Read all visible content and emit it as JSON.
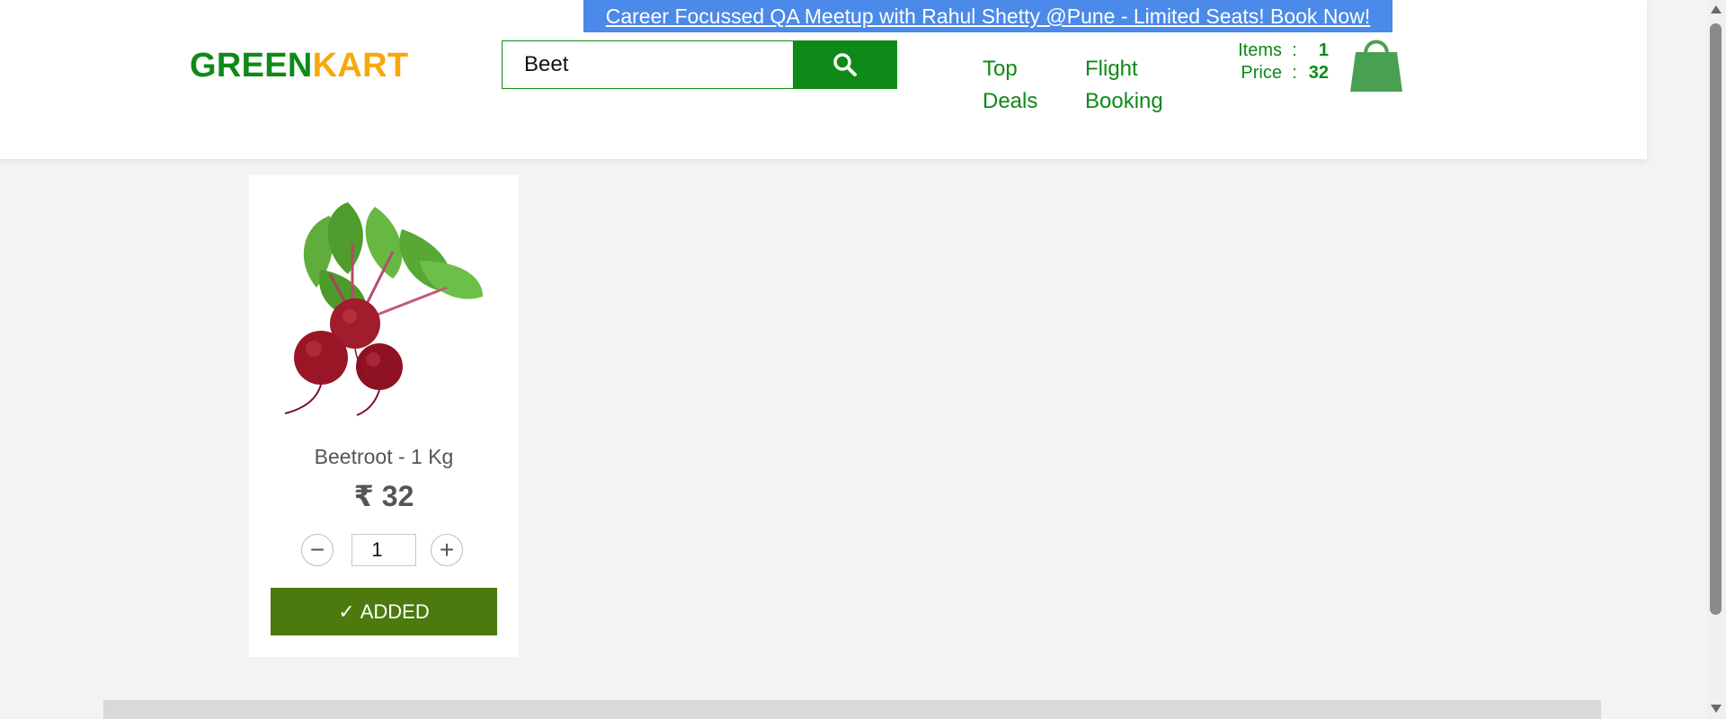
{
  "promo": {
    "text": "Career Focussed QA Meetup with Rahul Shetty @Pune - Limited Seats! Book Now!"
  },
  "logo": {
    "part1": "GREEN",
    "part2": "KART"
  },
  "search": {
    "value": "Beet",
    "button_icon": "search-icon"
  },
  "nav": {
    "top_deals": {
      "line1": "Top",
      "line2": "Deals"
    },
    "flight_booking": {
      "line1": "Flight",
      "line2": "Booking"
    }
  },
  "cart": {
    "items_label": "Items",
    "items_value": "1",
    "price_label": "Price",
    "price_value": "32",
    "separator": ":",
    "icon": "shopping-bag-icon"
  },
  "products": [
    {
      "name": "Beetroot - 1 Kg",
      "price": "₹ 32",
      "quantity": "1",
      "decrement_symbol": "−",
      "increment_symbol": "+",
      "button_label": "ADDED",
      "button_check": "✓",
      "image_icon": "beetroot-image"
    }
  ],
  "colors": {
    "brand_green": "#0d8a17",
    "brand_orange": "#f8a70c",
    "promo_blue": "#4b8ae8",
    "added_button": "#4c7a0f"
  }
}
